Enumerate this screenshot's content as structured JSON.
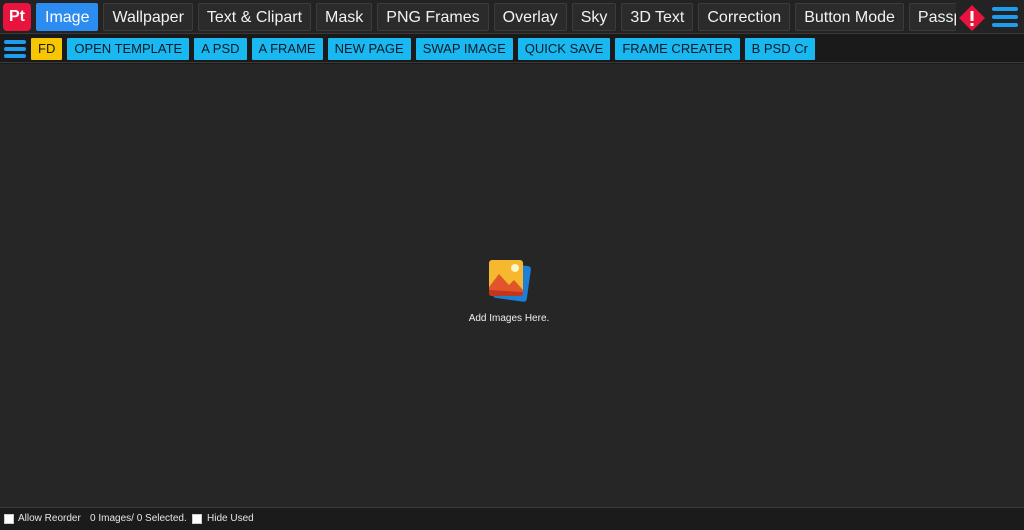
{
  "app": {
    "logo_text": "Pt",
    "brand_color": "#e8143d"
  },
  "tabs": [
    {
      "label": "Image",
      "active": true
    },
    {
      "label": "Wallpaper",
      "active": false
    },
    {
      "label": "Text & Clipart",
      "active": false
    },
    {
      "label": "Mask",
      "active": false
    },
    {
      "label": "PNG Frames",
      "active": false
    },
    {
      "label": "Overlay",
      "active": false
    },
    {
      "label": "Sky",
      "active": false
    },
    {
      "label": "3D Text",
      "active": false
    },
    {
      "label": "Correction",
      "active": false
    },
    {
      "label": "Button Mode",
      "active": false
    },
    {
      "label": "Passpor",
      "active": false
    }
  ],
  "icons": {
    "alert": "alert-diamond-icon",
    "menu": "hamburger-menu-icon",
    "placeholder": "image-gallery-icon"
  },
  "toolbar": {
    "buttons": [
      {
        "label": "FD",
        "variant": "yellow"
      },
      {
        "label": "OPEN TEMPLATE"
      },
      {
        "label": "A PSD"
      },
      {
        "label": "A FRAME"
      },
      {
        "label": "NEW PAGE"
      },
      {
        "label": "SWAP IMAGE"
      },
      {
        "label": "QUICK SAVE"
      },
      {
        "label": "FRAME CREATER"
      },
      {
        "label": "B PSD Cr"
      }
    ]
  },
  "canvas": {
    "placeholder_text": "Add Images Here."
  },
  "status": {
    "allow_reorder_label": "Allow Reorder",
    "count_text": "0 Images/ 0 Selected.",
    "hide_used_label": "Hide Used"
  },
  "colors": {
    "accent": "#2d8cf0",
    "toolbar_button": "#1ab8f0",
    "fd_button": "#f6c700",
    "alert": "#e8143d"
  }
}
